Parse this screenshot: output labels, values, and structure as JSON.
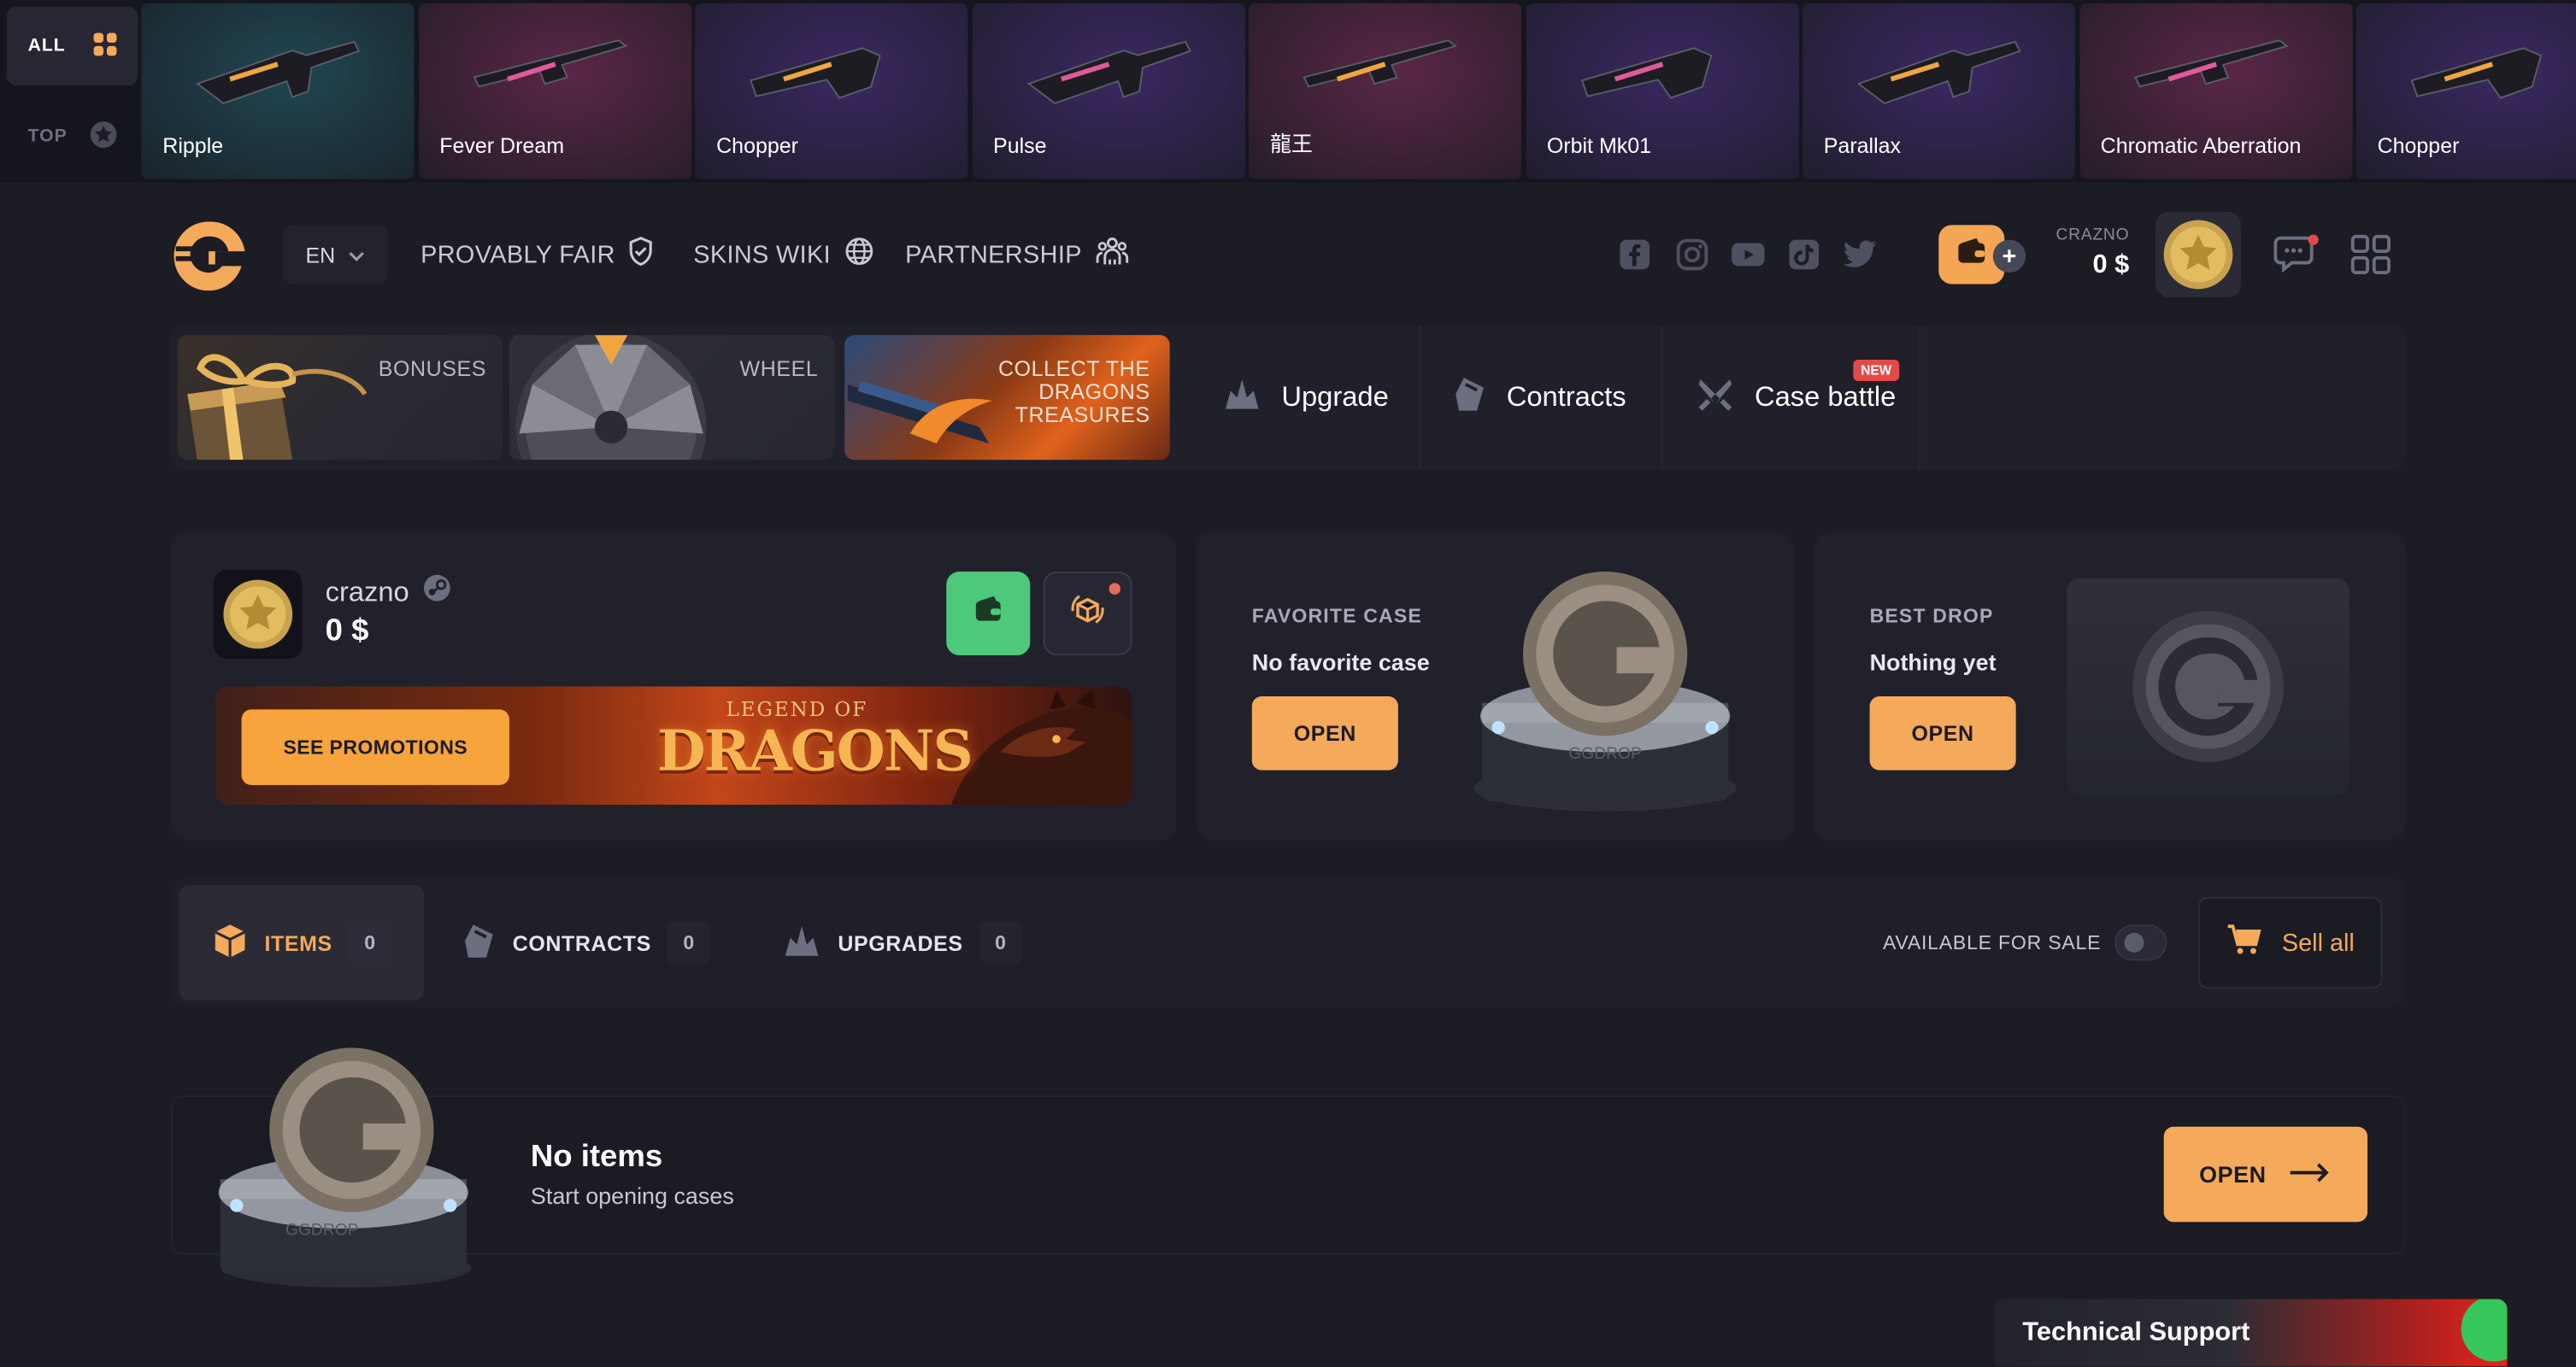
{
  "live_drops": {
    "modes": [
      {
        "label": "ALL",
        "icon": "grid-icon",
        "active": true
      },
      {
        "label": "TOP",
        "icon": "star-badge-icon",
        "active": false
      }
    ],
    "items": [
      {
        "label": "Ripple",
        "color": "#1f4752"
      },
      {
        "label": "Fever Dream",
        "color": "#5a2746"
      },
      {
        "label": "Chopper",
        "color": "#3b2862"
      },
      {
        "label": "Pulse",
        "color": "#3b2862"
      },
      {
        "label": "龍王",
        "color": "#5a2746"
      },
      {
        "label": "Orbit Mk01",
        "color": "#3b2862"
      },
      {
        "label": "Parallax",
        "color": "#3b2862"
      },
      {
        "label": "Chromatic Aberration",
        "color": "#5a2746"
      },
      {
        "label": "Chopper",
        "color": "#3b2862"
      }
    ]
  },
  "header": {
    "language": "EN",
    "nav": [
      {
        "label": "PROVABLY FAIR",
        "icon": "shield-check-icon"
      },
      {
        "label": "SKINS WIKI",
        "icon": "globe-icon"
      },
      {
        "label": "PARTNERSHIP",
        "icon": "people-icon"
      }
    ],
    "social_icons": [
      "facebook-icon",
      "instagram-icon",
      "youtube-icon",
      "tiktok-icon",
      "twitter-icon"
    ],
    "user": {
      "name": "CRAZNO",
      "balance": "0 $"
    }
  },
  "promo": {
    "tiles": [
      {
        "label": "BONUSES"
      },
      {
        "label": "WHEEL"
      },
      {
        "label": "COLLECT THE DRAGONS TREASURES"
      }
    ],
    "nav": [
      {
        "label": "Upgrade",
        "icon": "upgrade-icon"
      },
      {
        "label": "Contracts",
        "icon": "contract-icon"
      },
      {
        "label": "Case battle",
        "icon": "swords-icon",
        "badge": "NEW"
      }
    ]
  },
  "profile": {
    "name": "crazno",
    "balance": "0 $",
    "see_promotions": "SEE PROMOTIONS",
    "banner_small": "LEGEND OF",
    "banner_big": "DRAGONS"
  },
  "favorite_case": {
    "caption": "FAVORITE CASE",
    "value": "No favorite case",
    "button": "OPEN",
    "watermark": "GGDROP"
  },
  "best_drop": {
    "caption": "BEST DROP",
    "value": "Nothing yet",
    "button": "OPEN"
  },
  "tabs": [
    {
      "label": "ITEMS",
      "count": "0",
      "icon": "box-icon",
      "active": true
    },
    {
      "label": "CONTRACTS",
      "count": "0",
      "icon": "contract-icon",
      "active": false
    },
    {
      "label": "UPGRADES",
      "count": "0",
      "icon": "upgrade-icon",
      "active": false
    }
  ],
  "filters": {
    "available_for_sale": "AVAILABLE FOR SALE",
    "sell_all": "Sell all"
  },
  "empty_state": {
    "title": "No items",
    "subtitle": "Start opening cases",
    "button": "OPEN",
    "watermark": "GGDROP"
  },
  "support": {
    "label": "Technical Support"
  },
  "colors": {
    "accent": "#f4a95b",
    "background": "#1b1c24",
    "green": "#4ec97a",
    "new_badge": "#e24a4a"
  }
}
